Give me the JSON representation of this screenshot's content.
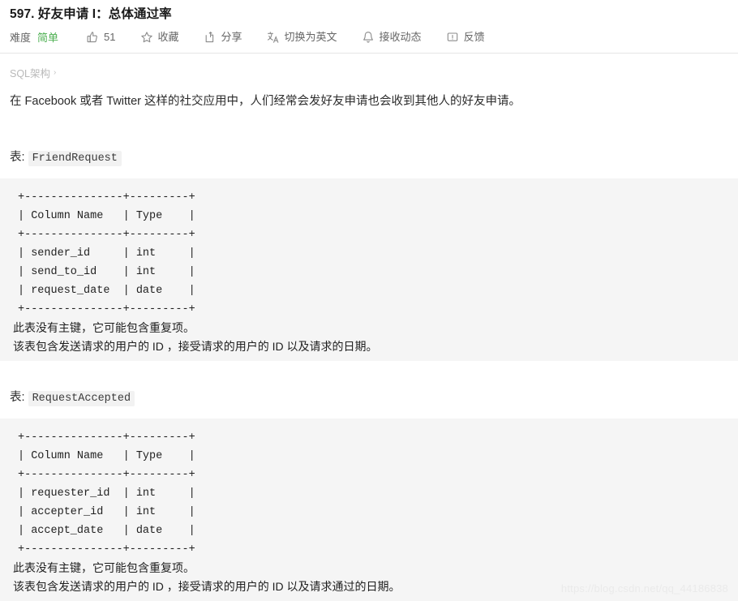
{
  "header": {
    "title": "597. 好友申请 I：总体通过率"
  },
  "toolbar": {
    "difficulty_label": "难度",
    "difficulty_value": "简单",
    "like_count": "51",
    "favorite_label": "收藏",
    "share_label": "分享",
    "translate_label": "切换为英文",
    "subscribe_label": "接收动态",
    "feedback_label": "反馈",
    "icons": {
      "like": "thumbs-up-icon",
      "favorite": "star-icon",
      "share": "share-icon",
      "translate": "translate-icon",
      "subscribe": "bell-icon",
      "feedback": "feedback-icon"
    }
  },
  "breadcrumb": {
    "item": "SQL架构",
    "chevron": "›"
  },
  "description": "在 Facebook 或者 Twitter 这样的社交应用中，人们经常会发好友申请也会收到其他人的好友申请。",
  "tables": [
    {
      "caption_prefix": "表:",
      "name": "FriendRequest",
      "ascii": "+---------------+---------+\n| Column Name   | Type    |\n+---------------+---------+\n| sender_id     | int     |\n| send_to_id    | int     |\n| request_date  | date    |\n+---------------+---------+",
      "notes": [
        "此表没有主键，它可能包含重复项。",
        "该表包含发送请求的用户的 ID ，接受请求的用户的 ID 以及请求的日期。"
      ],
      "columns": [
        {
          "name": "sender_id",
          "type": "int"
        },
        {
          "name": "send_to_id",
          "type": "int"
        },
        {
          "name": "request_date",
          "type": "date"
        }
      ],
      "headers": [
        "Column Name",
        "Type"
      ]
    },
    {
      "caption_prefix": "表:",
      "name": "RequestAccepted",
      "ascii": "+---------------+---------+\n| Column Name   | Type    |\n+---------------+---------+\n| requester_id  | int     |\n| accepter_id   | int     |\n| accept_date   | date    |\n+---------------+---------+",
      "notes": [
        "此表没有主键，它可能包含重复项。",
        "该表包含发送请求的用户的 ID ，接受请求的用户的 ID 以及请求通过的日期。"
      ],
      "columns": [
        {
          "name": "requester_id",
          "type": "int"
        },
        {
          "name": "accepter_id",
          "type": "int"
        },
        {
          "name": "accept_date",
          "type": "date"
        }
      ],
      "headers": [
        "Column Name",
        "Type"
      ]
    }
  ],
  "watermark": "https://blog.csdn.net/qq_44186838",
  "colors": {
    "difficulty_green": "#4caf50",
    "code_background": "#f5f5f5",
    "inline_code_background": "#f2f2f2",
    "divider": "#e6e6e6",
    "watermark": "#eaeaea"
  }
}
